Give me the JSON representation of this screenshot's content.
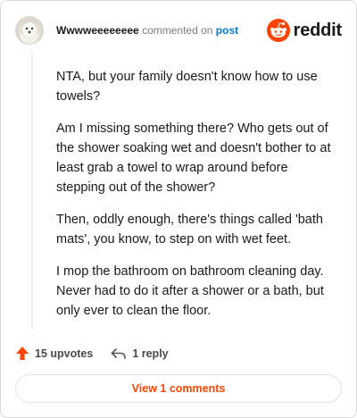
{
  "comment": {
    "username": "Wwwweeeeeeee",
    "action": "commented on",
    "target": "post",
    "paragraphs": [
      "NTA, but your family doesn't know how to use towels?",
      "Am I missing something there? Who gets out of the shower soaking wet and doesn't bother to at least grab a towel to wrap around before stepping out of the shower?",
      "Then, oddly enough, there's things called 'bath mats', you know, to step on with wet feet.",
      "I mop the bathroom on bathroom cleaning day. Never had to do it after a shower or a bath, but only ever to clean the floor."
    ]
  },
  "brand": {
    "name": "reddit",
    "color": "#ff4500"
  },
  "footer": {
    "upvotes": "15 upvotes",
    "replies": "1 reply"
  },
  "view_button": {
    "label": "View 1 comments"
  },
  "colors": {
    "upvote": "#ff4500",
    "link": "#0079d3"
  },
  "icons": {
    "upvote": "upvote-arrow-icon",
    "reply": "reply-arrow-icon",
    "logo": "reddit-snoo-icon"
  }
}
